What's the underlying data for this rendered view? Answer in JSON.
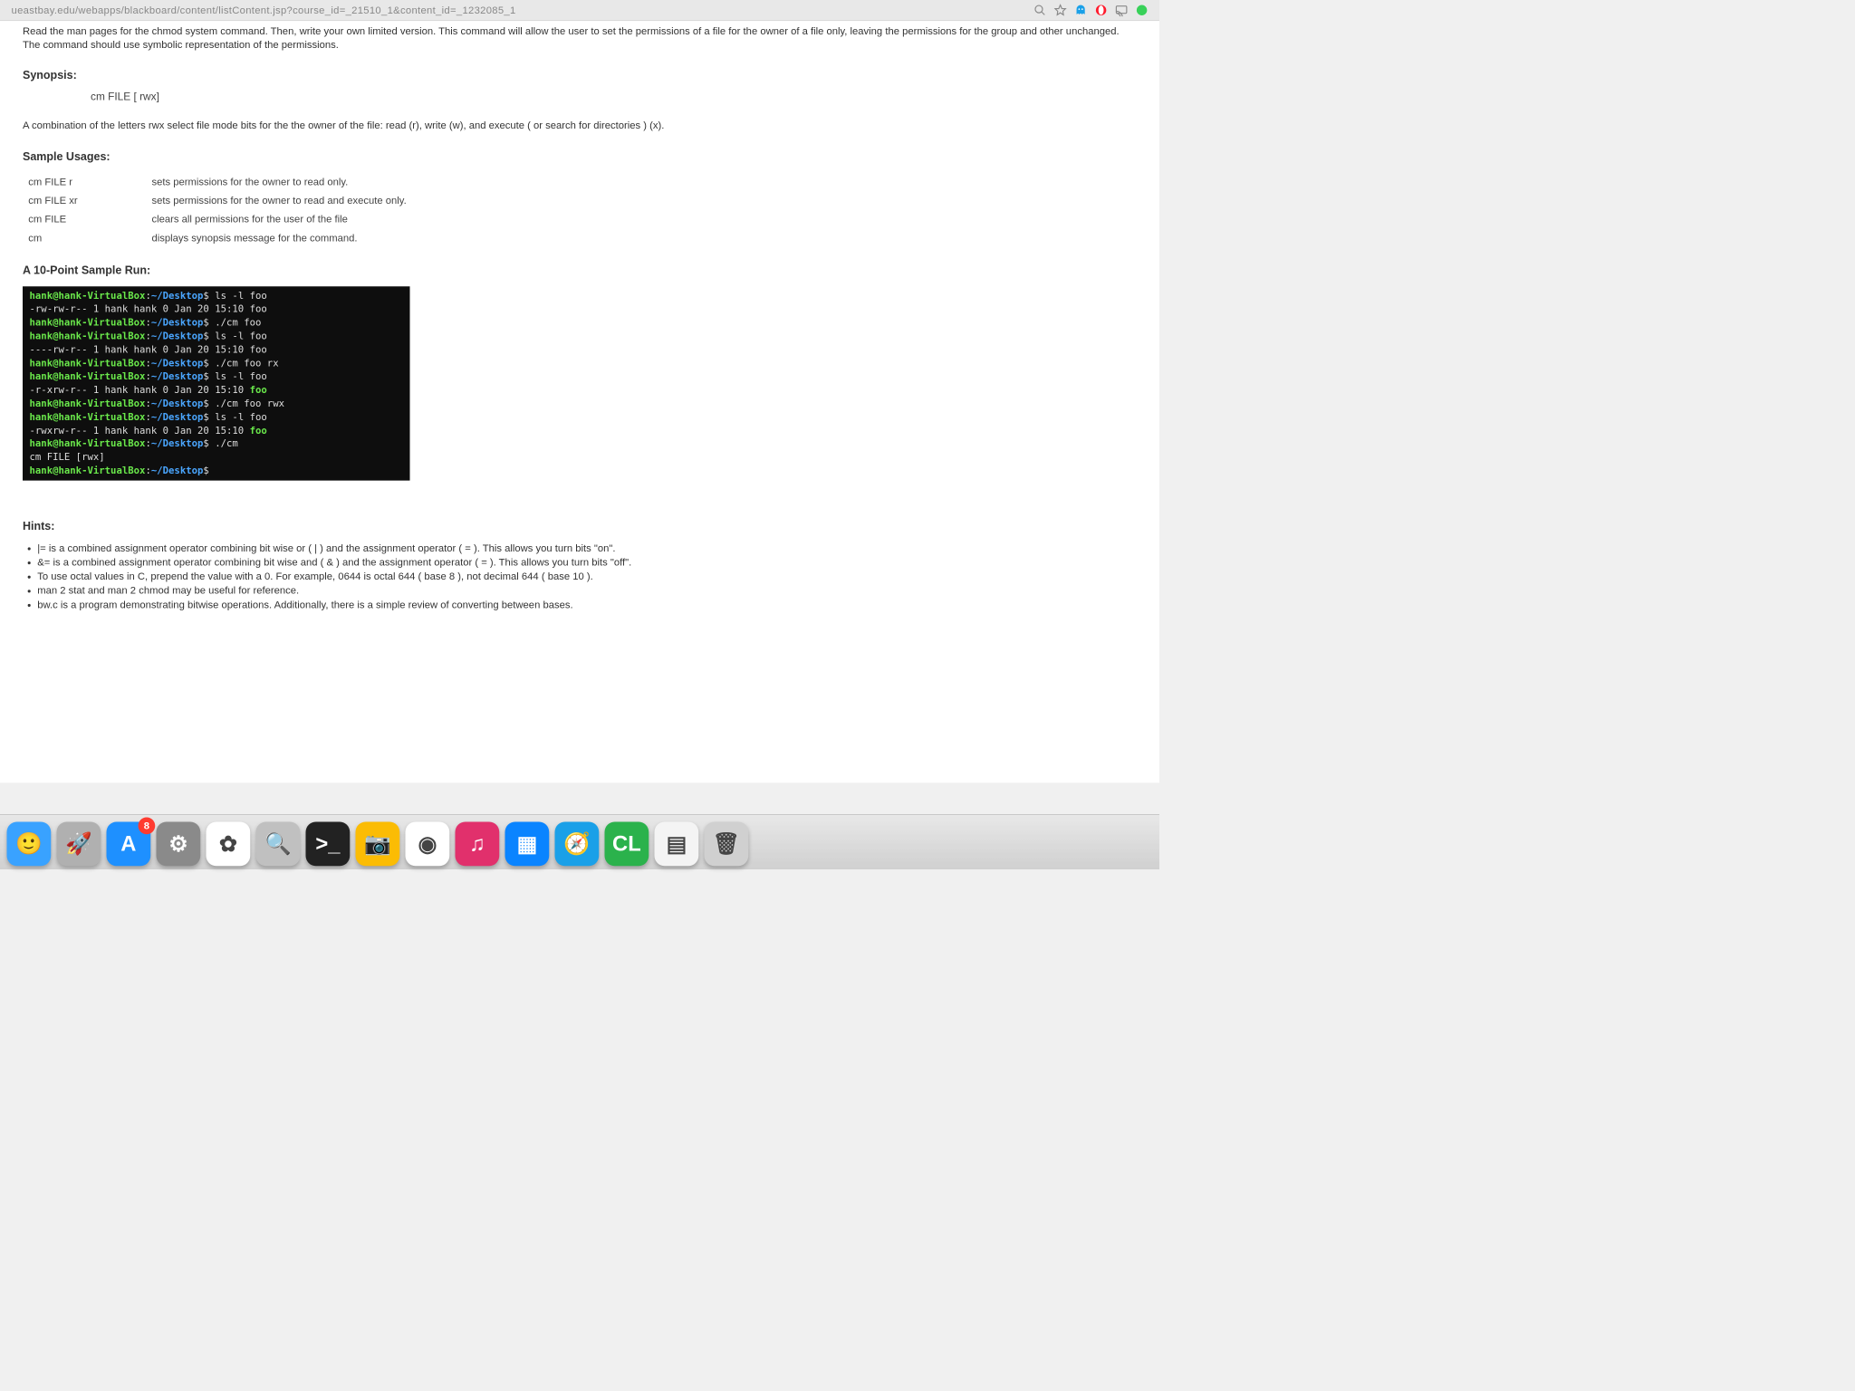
{
  "url_bar": {
    "url": "ueastbay.edu/webapps/blackboard/content/listContent.jsp?course_id=_21510_1&content_id=_1232085_1"
  },
  "page": {
    "intro": "Read the man pages for the chmod system command.  Then, write your own limited version. This command will allow the user to set the permissions of a file for the owner of a file only, leaving the permissions for the group and other unchanged.  The command should use symbolic representation of the permissions.",
    "synopsis_label": "Synopsis:",
    "synopsis_cmd": "cm FILE [ rwx]",
    "combo_desc": "A combination of the letters   rwx select file mode bits for the  the owner of the file:  read (r), write (w), and execute ( or search for directories ) (x).",
    "sample_usages_label": "Sample Usages:",
    "usages": [
      {
        "cmd": "cm FILE r",
        "desc": "sets permissions for the owner to read only."
      },
      {
        "cmd": "cm FILE  xr",
        "desc": "sets permissions for the owner to read and execute only."
      },
      {
        "cmd": "cm FILE",
        "desc": "clears all permissions for the user of the file"
      },
      {
        "cmd": "cm",
        "desc": "displays synopsis message for the command."
      }
    ],
    "sample_run_label": "A 10-Point Sample Run:",
    "terminal": {
      "user": "hank@hank-VirtualBox",
      "path": "~/Desktop",
      "lines": [
        {
          "t": "prompt",
          "cmd": "ls -l foo"
        },
        {
          "t": "out",
          "text": "-rw-rw-r-- 1 hank hank 0 Jan 20 15:10 foo"
        },
        {
          "t": "prompt",
          "cmd": "./cm foo"
        },
        {
          "t": "prompt",
          "cmd": "ls -l foo"
        },
        {
          "t": "out",
          "text": "----rw-r-- 1 hank hank 0 Jan 20 15:10 foo"
        },
        {
          "t": "prompt",
          "cmd": "./cm foo rx"
        },
        {
          "t": "prompt",
          "cmd": "ls -l foo"
        },
        {
          "t": "outf",
          "text": "-r-xrw-r-- 1 hank hank 0 Jan 20 15:10 ",
          "file": "foo"
        },
        {
          "t": "prompt",
          "cmd": "./cm foo rwx"
        },
        {
          "t": "prompt",
          "cmd": "ls -l foo"
        },
        {
          "t": "outf",
          "text": "-rwxrw-r-- 1 hank hank 0 Jan 20 15:10 ",
          "file": "foo"
        },
        {
          "t": "prompt",
          "cmd": "./cm"
        },
        {
          "t": "out",
          "text": "cm FILE [rwx]"
        },
        {
          "t": "prompt",
          "cmd": ""
        }
      ]
    },
    "hints_label": "Hints:",
    "hints": [
      "|= is a combined assignment operator combining bit wise or ( | ) and the assignment operator ( = ). This allows you turn bits \"on\".",
      "&= is a combined assignment operator combining bit wise and ( & ) and the assignment operator ( = ). This allows you turn bits \"off\".",
      "To use octal values in C, prepend the value with a 0. For example, 0644 is octal 644 ( base 8 ), not decimal 644 ( base 10 ).",
      "man 2 stat and man 2 chmod may be useful for reference.",
      "bw.c is a program demonstrating bitwise operations.  Additionally, there is a simple review of converting between bases."
    ]
  },
  "dock": {
    "apps": [
      {
        "name": "finder",
        "badge": null,
        "bg": "#39a2ff",
        "glyph": "🙂"
      },
      {
        "name": "launchpad",
        "badge": null,
        "bg": "#b0b0b0",
        "glyph": "🚀"
      },
      {
        "name": "appstore",
        "badge": "8",
        "bg": "#1e90ff",
        "glyph": "A"
      },
      {
        "name": "settings",
        "badge": null,
        "bg": "#8a8a8a",
        "glyph": "⚙"
      },
      {
        "name": "photos",
        "badge": null,
        "bg": "#ffffff",
        "glyph": "✿"
      },
      {
        "name": "spotlight",
        "badge": null,
        "bg": "#c0c0c0",
        "glyph": "🔍"
      },
      {
        "name": "terminal",
        "badge": null,
        "bg": "#222222",
        "glyph": ">_"
      },
      {
        "name": "camera",
        "badge": null,
        "bg": "#fbbc04",
        "glyph": "📷"
      },
      {
        "name": "chrome",
        "badge": null,
        "bg": "#ffffff",
        "glyph": "◉"
      },
      {
        "name": "itunes",
        "badge": null,
        "bg": "#e1306c",
        "glyph": "♫"
      },
      {
        "name": "keynote",
        "badge": null,
        "bg": "#0a84ff",
        "glyph": "▦"
      },
      {
        "name": "safari",
        "badge": null,
        "bg": "#1aa0e8",
        "glyph": "🧭"
      },
      {
        "name": "clion",
        "badge": null,
        "bg": "#2bb24c",
        "glyph": "CL"
      },
      {
        "name": "scanner",
        "badge": null,
        "bg": "#f4f4f4",
        "glyph": "▤"
      },
      {
        "name": "trash",
        "badge": null,
        "bg": "#d0d0d0",
        "glyph": "🗑"
      }
    ]
  }
}
